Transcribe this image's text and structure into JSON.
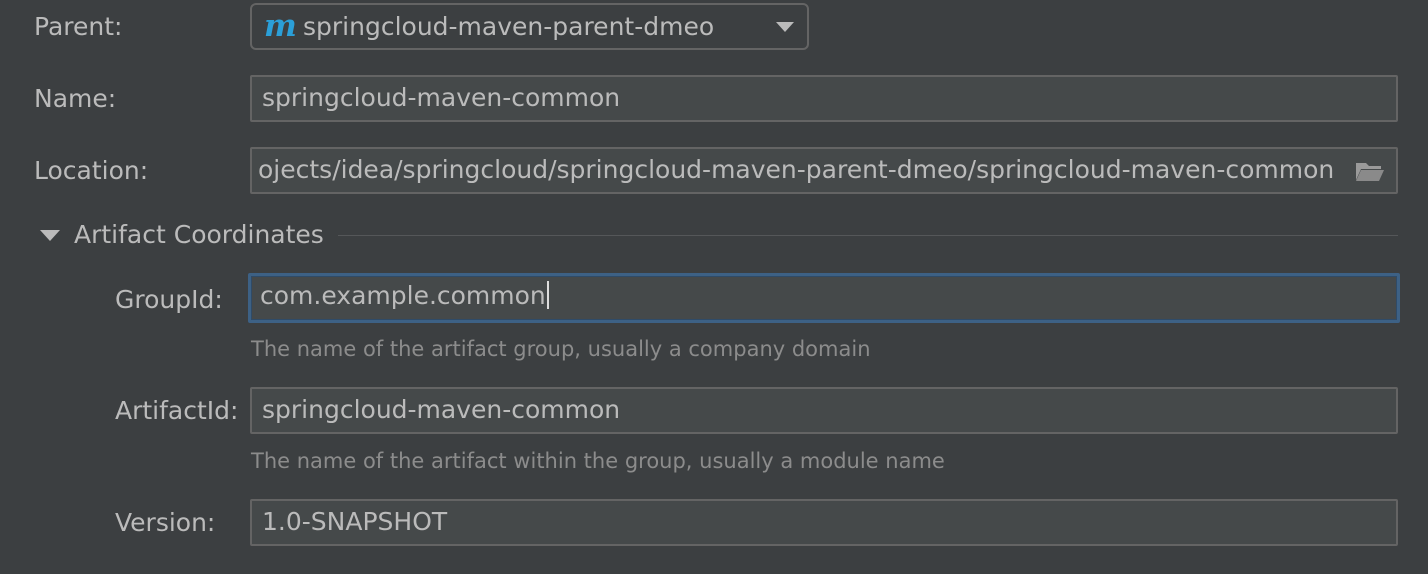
{
  "form": {
    "parent": {
      "label": "Parent:",
      "value": "springcloud-maven-parent-dmeo",
      "icon_text": "m",
      "icon": "maven-icon",
      "arrow_icon": "dropdown-arrow-icon"
    },
    "name": {
      "label": "Name:",
      "value": "springcloud-maven-common"
    },
    "location": {
      "label": "Location:",
      "value": "ojects/idea/springcloud/springcloud-maven-parent-dmeo/springcloud-maven-common",
      "browse_icon": "folder-icon"
    },
    "artifact_section": {
      "title": "Artifact Coordinates",
      "expanded": true,
      "toggle_icon": "triangle-down-icon"
    },
    "group_id": {
      "label": "GroupId:",
      "value": "com.example.common",
      "hint": "The name of the artifact group, usually a company domain"
    },
    "artifact_id": {
      "label": "ArtifactId:",
      "value": "springcloud-maven-common",
      "hint": "The name of the artifact within the group, usually a module name"
    },
    "version": {
      "label": "Version:",
      "value": "1.0-SNAPSHOT"
    }
  },
  "colors": {
    "background": "#3c3f41",
    "field_background": "#45494a",
    "focus_border": "#3d6185",
    "maven_icon": "#2b9fd8"
  }
}
